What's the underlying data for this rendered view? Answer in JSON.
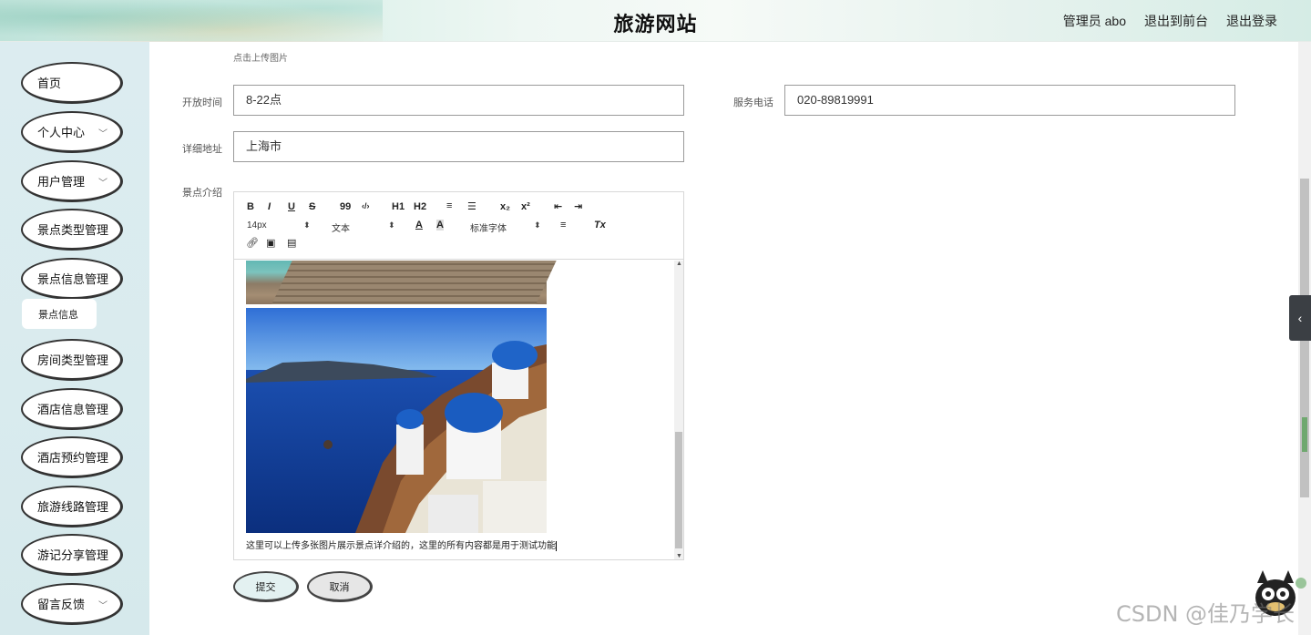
{
  "header": {
    "title": "旅游网站",
    "admin_label": "管理员 abo",
    "back_to_front": "退出到前台",
    "logout": "退出登录"
  },
  "sidebar": {
    "items": [
      {
        "label": "首页",
        "has_dropdown": false
      },
      {
        "label": "个人中心",
        "has_dropdown": true
      },
      {
        "label": "用户管理",
        "has_dropdown": true
      },
      {
        "label": "景点类型管理",
        "has_dropdown": false
      },
      {
        "label": "景点信息管理",
        "has_dropdown": false
      },
      {
        "label": "房间类型管理",
        "has_dropdown": false
      },
      {
        "label": "酒店信息管理",
        "has_dropdown": false
      },
      {
        "label": "酒店预约管理",
        "has_dropdown": false
      },
      {
        "label": "旅游线路管理",
        "has_dropdown": false
      },
      {
        "label": "游记分享管理",
        "has_dropdown": false
      },
      {
        "label": "留言反馈",
        "has_dropdown": true
      }
    ],
    "submenu": {
      "label": "景点信息"
    }
  },
  "form": {
    "upload_hint": "点击上传图片",
    "open_time": {
      "label": "开放时间",
      "value": "8-22点"
    },
    "service_phone": {
      "label": "服务电话",
      "value": "020-89819991"
    },
    "address": {
      "label": "详细地址",
      "value": "上海市"
    },
    "intro": {
      "label": "景点介绍"
    }
  },
  "editor": {
    "toolbar": {
      "bold": "B",
      "italic": "I",
      "underline": "U",
      "strike": "S",
      "quote": "99",
      "code": "‹/›",
      "h1": "H1",
      "h2": "H2",
      "ordered_list": "≡",
      "bullet_list": "☰",
      "subscript": "x₂",
      "superscript": "x²",
      "outdent": "⇤",
      "indent": "⇥",
      "size": "14px",
      "header_picker": "文本",
      "font_picker": "标准字体",
      "color": "A",
      "background": "A",
      "align": "≡",
      "clean": "Tx",
      "link": "🔗",
      "image": "▣",
      "video": "▤"
    },
    "content_text": "这里可以上传多张图片展示景点详介绍的，这里的所有内容都是用于测试功能"
  },
  "buttons": {
    "submit": "提交",
    "cancel": "取消"
  },
  "side_tab": {
    "icon": "chevron-left"
  },
  "watermark": "CSDN @佳乃学长",
  "colors": {
    "sidebar_bg": "#d9ebee",
    "submit_bg": "#e3f1f1",
    "cancel_bg": "#e6e6e6",
    "field_border": "#9a9a9a"
  }
}
